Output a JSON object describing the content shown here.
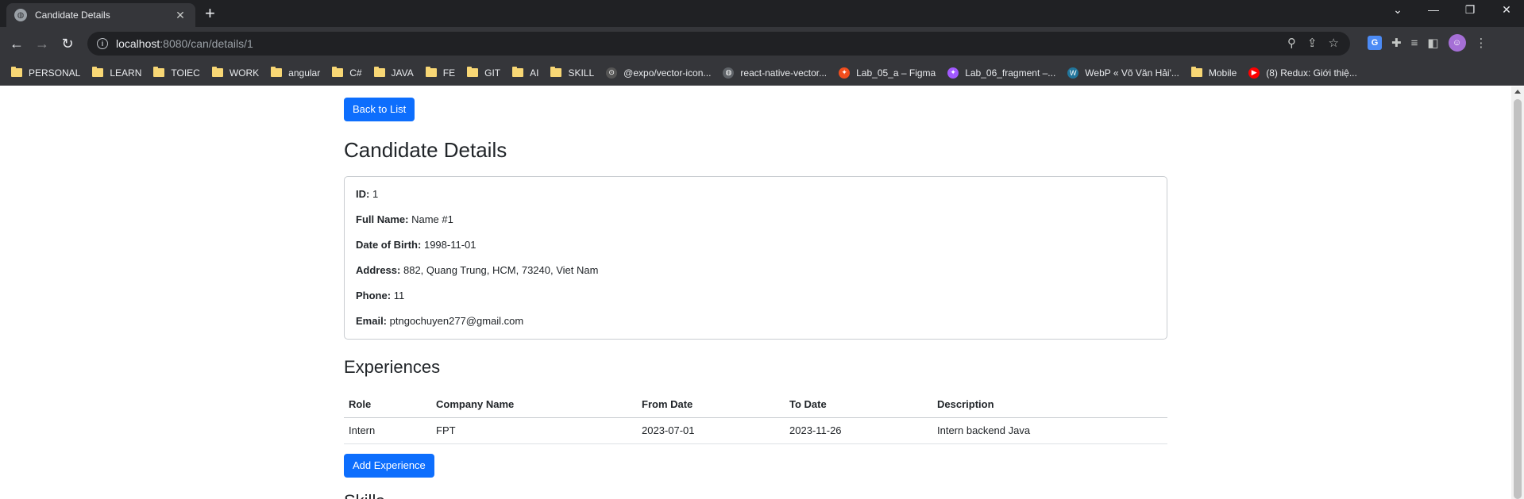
{
  "browser": {
    "tab_title": "Candidate Details",
    "url_host": "localhost",
    "url_rest": ":8080/can/details/1",
    "bookmarks": [
      {
        "label": "PERSONAL",
        "kind": "folder"
      },
      {
        "label": "LEARN",
        "kind": "folder"
      },
      {
        "label": "TOIEC",
        "kind": "folder"
      },
      {
        "label": "WORK",
        "kind": "folder"
      },
      {
        "label": "angular",
        "kind": "folder"
      },
      {
        "label": "C#",
        "kind": "folder"
      },
      {
        "label": "JAVA",
        "kind": "folder"
      },
      {
        "label": "FE",
        "kind": "folder"
      },
      {
        "label": "GIT",
        "kind": "folder"
      },
      {
        "label": "AI",
        "kind": "folder"
      },
      {
        "label": "SKILL",
        "kind": "folder"
      },
      {
        "label": "@expo/vector-icon...",
        "kind": "site",
        "icon": "expo-icon",
        "color": "#555555"
      },
      {
        "label": "react-native-vector...",
        "kind": "site",
        "icon": "globe-icon",
        "color": "#5f6368"
      },
      {
        "label": "Lab_05_a – Figma",
        "kind": "site",
        "icon": "figma-icon",
        "color": "#f24e1e"
      },
      {
        "label": "Lab_06_fragment –...",
        "kind": "site",
        "icon": "figma-icon",
        "color": "#a259ff"
      },
      {
        "label": "WebP « Võ Văn Hải'...",
        "kind": "site",
        "icon": "wordpress-icon",
        "color": "#21759b"
      },
      {
        "label": "Mobile",
        "kind": "folder"
      },
      {
        "label": "(8) Redux: Giới thiệ...",
        "kind": "site",
        "icon": "youtube-icon",
        "color": "#ff0000"
      }
    ]
  },
  "page": {
    "back_label": "Back to List",
    "title": "Candidate Details",
    "details": [
      {
        "label": "ID:",
        "value": "1"
      },
      {
        "label": "Full Name:",
        "value": "Name #1"
      },
      {
        "label": "Date of Birth:",
        "value": "1998-11-01"
      },
      {
        "label": "Address:",
        "value": "882, Quang Trung, HCM, 73240, Viet Nam"
      },
      {
        "label": "Phone:",
        "value": "11"
      },
      {
        "label": "Email:",
        "value": "ptngochuyen277@gmail.com"
      }
    ],
    "experiences_title": "Experiences",
    "table": {
      "headers": [
        "Role",
        "Company Name",
        "From Date",
        "To Date",
        "Description"
      ],
      "rows": [
        [
          "Intern",
          "FPT",
          "2023-07-01",
          "2023-11-26",
          "Intern backend Java"
        ]
      ]
    },
    "add_label": "Add Experience",
    "next_section_partial": "Skills"
  },
  "colors": {
    "primary": "#0d6efd",
    "chrome_dark": "#202124",
    "chrome_toolbar": "#35363a"
  }
}
